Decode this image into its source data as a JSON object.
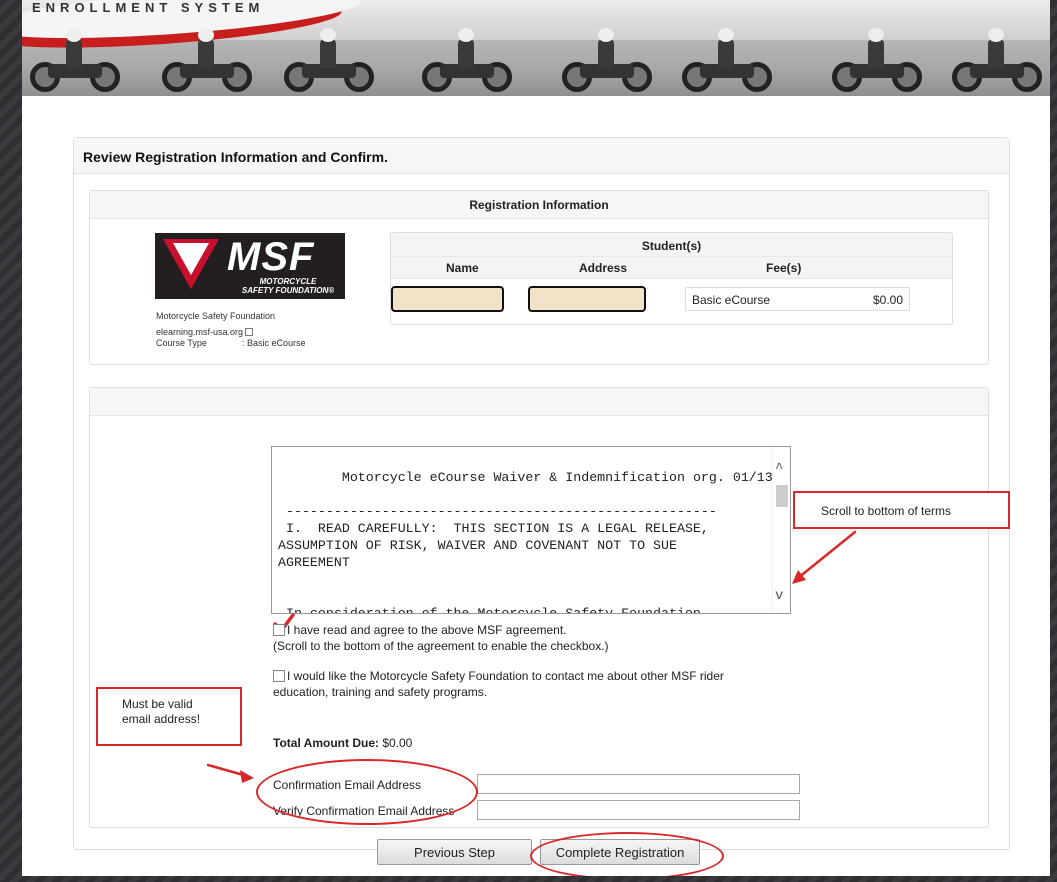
{
  "banner": {
    "brand": "ENROLLMENT SYSTEM"
  },
  "page": {
    "title": "Review Registration Information and Confirm.",
    "registration_heading": "Registration Information"
  },
  "logo": {
    "big": "MSF",
    "line1": "MOTORCYCLE",
    "line2": "SAFETY FOUNDATION®"
  },
  "provider": {
    "name": "Motorcycle Safety Foundation",
    "link": "elearning.msf-usa.org",
    "course_type_label": "Course Type",
    "course_type_value": ": Basic eCourse"
  },
  "students": {
    "heading": "Student(s)",
    "columns": [
      "Name",
      "Address",
      "Fee(s)"
    ],
    "rows": [
      {
        "course": "Basic eCourse",
        "fee": "$0.00"
      }
    ]
  },
  "terms": {
    "text": "Motorcycle eCourse Waiver & Indemnification org. 01/13\n\n ------------------------------------------------------\n I.  READ CAREFULLY:  THIS SECTION IS A LEGAL RELEASE,\nASSUMPTION OF RISK, WAIVER AND COVENANT NOT TO SUE\nAGREEMENT\n\n\n In consideration of the Motorcycle Safety Foundation,\nthe training sponsor and their members, employees,",
    "up_arrow": "^",
    "down_arrow": "v"
  },
  "agreement": {
    "label": "I have read and agree to the above MSF agreement.",
    "hint": "(Scroll to the bottom of the agreement to enable the checkbox.)"
  },
  "contact_optin": {
    "label_line1": "I would like the Motorcycle Safety Foundation to contact me about other MSF rider",
    "label_line2": "education, training and safety programs."
  },
  "total": {
    "label": "Total Amount Due:",
    "value": " $0.00"
  },
  "email": {
    "confirm_label": "Confirmation Email Address",
    "verify_label": "Verify Confirmation Email Address"
  },
  "buttons": {
    "previous": "Previous Step",
    "complete": "Complete Registration"
  },
  "annotations": {
    "scroll_note": "Scroll to bottom of terms",
    "email_note_line1": "Must be valid",
    "email_note_line2": "email address!"
  },
  "colors": {
    "annotation_red": "#d9282a",
    "msf_red": "#c8102e",
    "redaction": "#f1e3c8"
  }
}
